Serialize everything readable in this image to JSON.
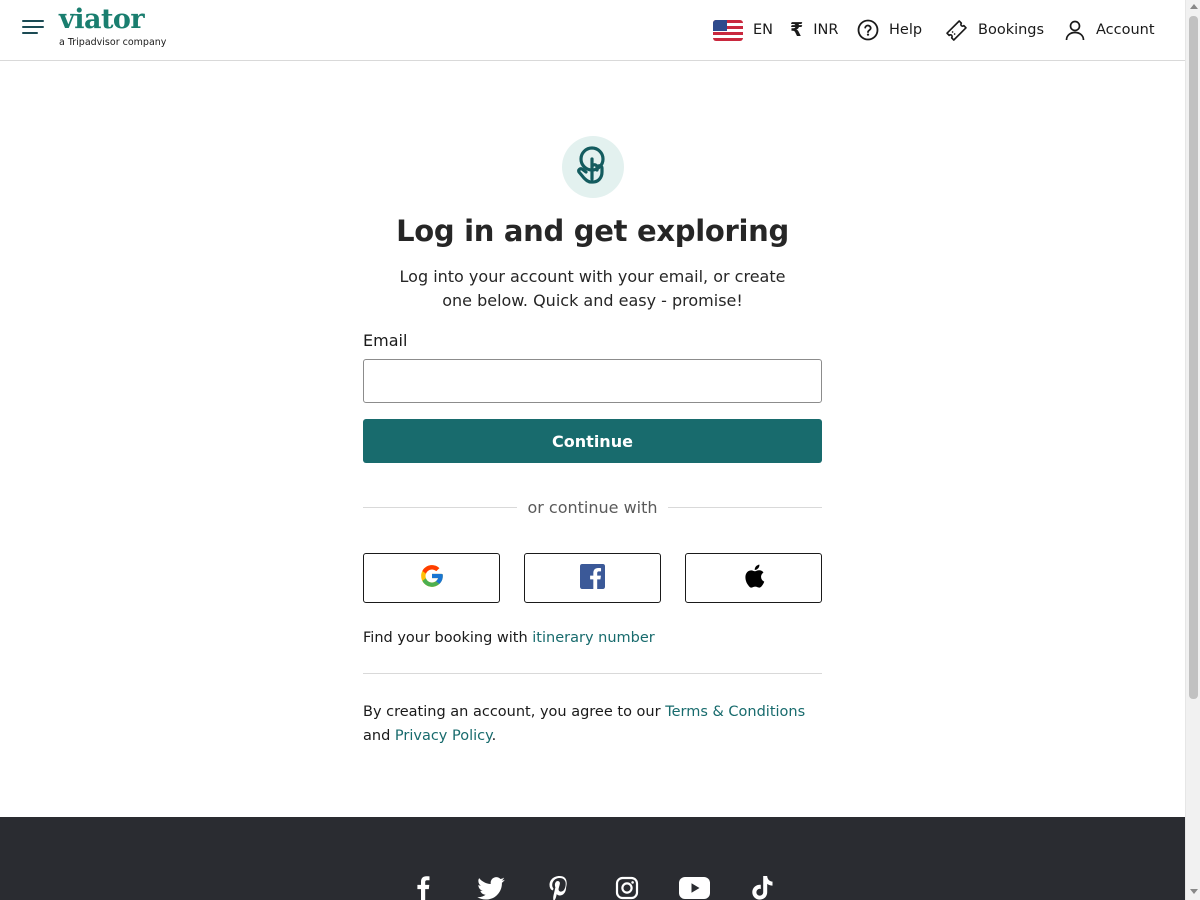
{
  "header": {
    "logo_text": "viator",
    "logo_subtitle": "a Tripadvisor company",
    "language": "EN",
    "currency_symbol": "₹",
    "currency": "INR",
    "help_label": "Help",
    "bookings_label": "Bookings",
    "account_label": "Account"
  },
  "login": {
    "title": "Log in and get exploring",
    "subtitle": "Log into your account with your email, or create one below. Quick and easy - promise!",
    "email_label": "Email",
    "email_value": "",
    "continue_label": "Continue",
    "divider_text": "or continue with",
    "find_booking_prefix": "Find your booking with ",
    "find_booking_link": "itinerary number",
    "terms_prefix": "By creating an account, you agree to our ",
    "terms_link": "Terms & Conditions",
    "terms_and": "and ",
    "privacy_link": "Privacy Policy",
    "terms_suffix": "."
  },
  "social_login": [
    "google-icon",
    "facebook-icon",
    "apple-icon"
  ],
  "footer": {
    "social_icons": [
      "facebook-icon",
      "twitter-icon",
      "pinterest-icon",
      "instagram-icon",
      "youtube-icon",
      "tiktok-icon"
    ]
  },
  "colors": {
    "brand": "#186b6d",
    "logo": "#1a7e6f",
    "footer_bg": "#2a2c31"
  }
}
